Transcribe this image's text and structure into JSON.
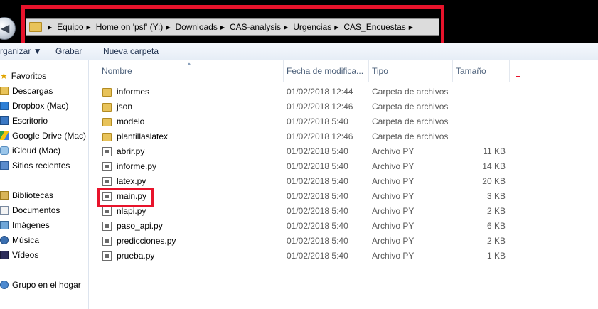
{
  "breadcrumbs": [
    "Equipo",
    "Home on 'psf' (Y:)",
    "Downloads",
    "CAS-analysis",
    "Urgencias",
    "CAS_Encuestas"
  ],
  "toolbar": {
    "organize": "rganizar ▼",
    "record": "Grabar",
    "new_folder": "Nueva carpeta"
  },
  "nav": {
    "favorites": {
      "header": "Favoritos",
      "items": [
        "Descargas",
        "Dropbox (Mac)",
        "Escritorio",
        "Google Drive (Mac)",
        "iCloud (Mac)",
        "Sitios recientes"
      ]
    },
    "libraries": {
      "header": "Bibliotecas",
      "items": [
        "Documentos",
        "Imágenes",
        "Música",
        "Vídeos"
      ]
    },
    "homegroup": "Grupo en el hogar"
  },
  "columns": {
    "name": "Nombre",
    "date": "Fecha de modifica...",
    "type": "Tipo",
    "size": "Tamaño"
  },
  "files": [
    {
      "name": "informes",
      "date": "01/02/2018 12:44",
      "type": "Carpeta de archivos",
      "size": "",
      "kind": "folder"
    },
    {
      "name": "json",
      "date": "01/02/2018 12:46",
      "type": "Carpeta de archivos",
      "size": "",
      "kind": "folder"
    },
    {
      "name": "modelo",
      "date": "01/02/2018 5:40",
      "type": "Carpeta de archivos",
      "size": "",
      "kind": "folder"
    },
    {
      "name": "plantillaslatex",
      "date": "01/02/2018 12:46",
      "type": "Carpeta de archivos",
      "size": "",
      "kind": "folder"
    },
    {
      "name": "abrir.py",
      "date": "01/02/2018 5:40",
      "type": "Archivo PY",
      "size": "11 KB",
      "kind": "py"
    },
    {
      "name": "informe.py",
      "date": "01/02/2018 5:40",
      "type": "Archivo PY",
      "size": "14 KB",
      "kind": "py"
    },
    {
      "name": "latex.py",
      "date": "01/02/2018 5:40",
      "type": "Archivo PY",
      "size": "20 KB",
      "kind": "py"
    },
    {
      "name": "main.py",
      "date": "01/02/2018 5:40",
      "type": "Archivo PY",
      "size": "3 KB",
      "kind": "py"
    },
    {
      "name": "nlapi.py",
      "date": "01/02/2018 5:40",
      "type": "Archivo PY",
      "size": "2 KB",
      "kind": "py"
    },
    {
      "name": "paso_api.py",
      "date": "01/02/2018 5:40",
      "type": "Archivo PY",
      "size": "6 KB",
      "kind": "py"
    },
    {
      "name": "predicciones.py",
      "date": "01/02/2018 5:40",
      "type": "Archivo PY",
      "size": "2 KB",
      "kind": "py"
    },
    {
      "name": "prueba.py",
      "date": "01/02/2018 5:40",
      "type": "Archivo PY",
      "size": "1 KB",
      "kind": "py"
    }
  ],
  "colors": {
    "highlight": "#e8132b",
    "folder": "#e8c35a"
  }
}
